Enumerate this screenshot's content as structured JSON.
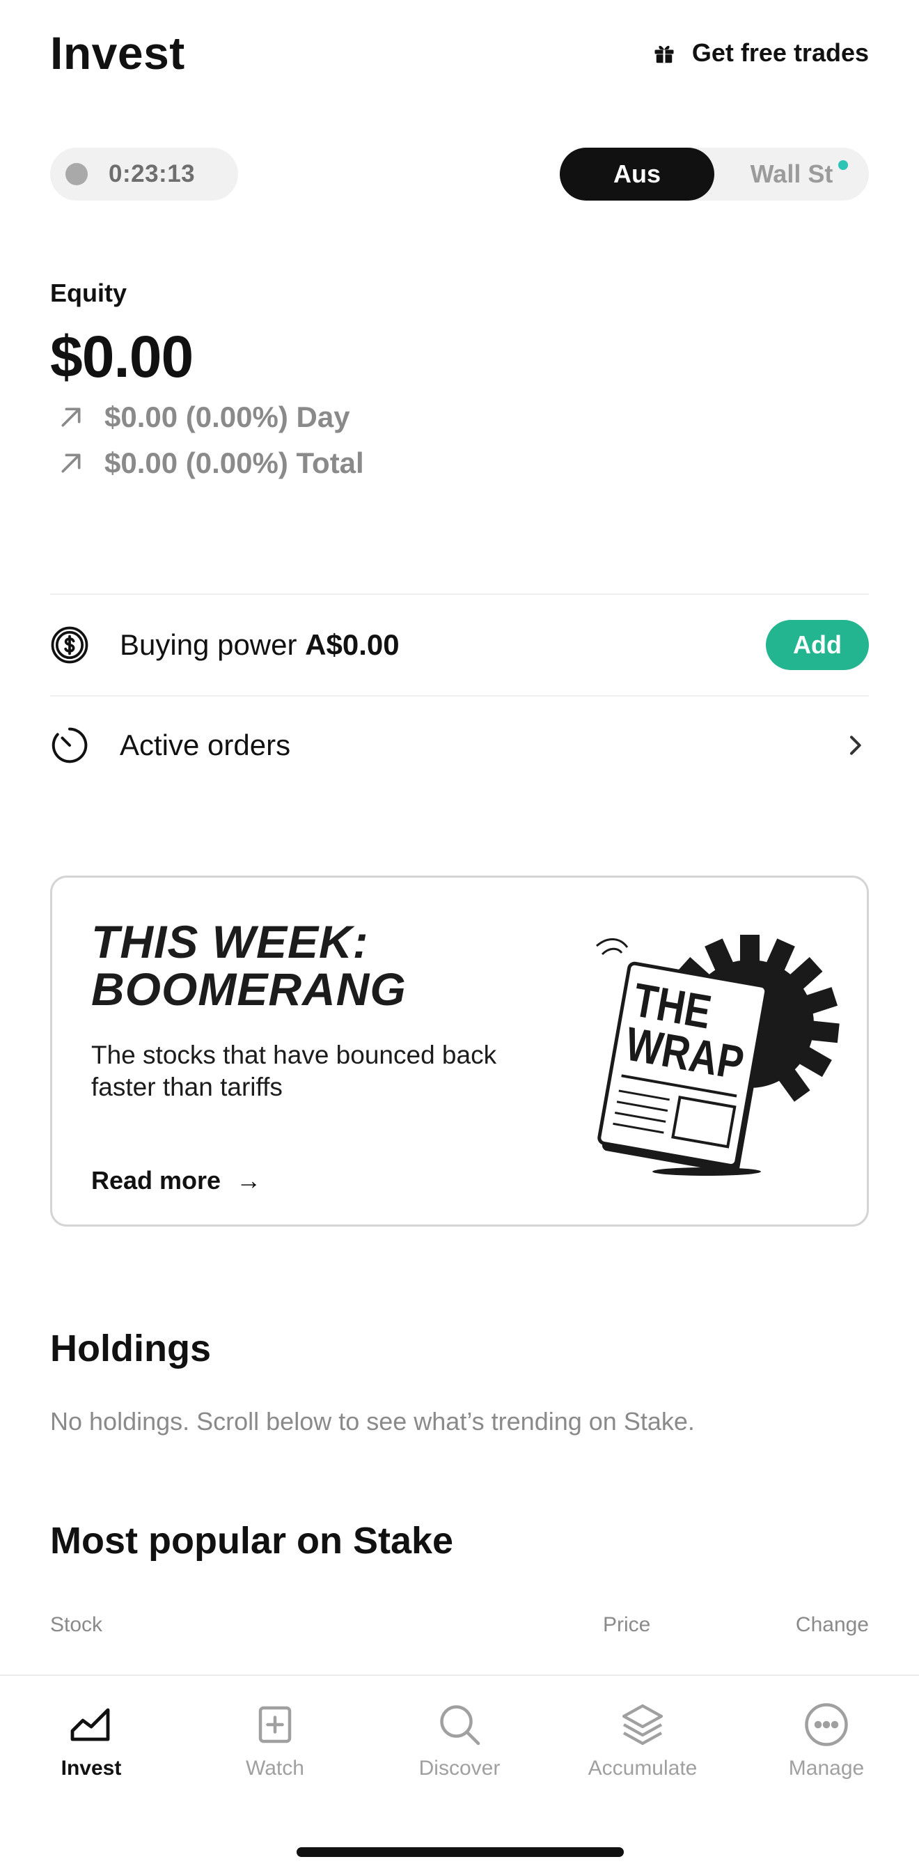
{
  "header": {
    "title": "Invest",
    "free_trades_label": "Get free trades",
    "free_trades_icon": "gift-icon"
  },
  "market_controls": {
    "timer": "0:23:13",
    "tabs": [
      {
        "label": "Aus",
        "active": true
      },
      {
        "label": "Wall St",
        "active": false
      }
    ],
    "accent": "#2bc4b5"
  },
  "equity": {
    "label": "Equity",
    "value": "$0.00",
    "day": "$0.00 (0.00%) Day",
    "total": "$0.00 (0.00%) Total"
  },
  "buying_power": {
    "label": "Buying power",
    "amount": "A$0.00",
    "add_label": "Add",
    "add_color": "#22b58f"
  },
  "active_orders": {
    "label": "Active orders"
  },
  "promo": {
    "title_line1": "THIS WEEK:",
    "title_line2": "BOOMERANG",
    "description": "The stocks that have bounced back faster than tariffs",
    "link_label": "Read more",
    "link_arrow": "→",
    "art_line1": "THE",
    "art_line2": "WRAP"
  },
  "holdings": {
    "title": "Holdings",
    "empty_text": "No holdings. Scroll below to see what’s trending on Stake."
  },
  "popular": {
    "title": "Most popular on Stake",
    "columns": [
      "Stock",
      "Price",
      "Change"
    ]
  },
  "tabbar": {
    "items": [
      {
        "label": "Invest",
        "icon": "chart-icon",
        "active": true
      },
      {
        "label": "Watch",
        "icon": "plus-square-icon",
        "active": false
      },
      {
        "label": "Discover",
        "icon": "search-icon",
        "active": false
      },
      {
        "label": "Accumulate",
        "icon": "layers-icon",
        "active": false
      },
      {
        "label": "Manage",
        "icon": "more-circle-icon",
        "active": false
      }
    ]
  }
}
